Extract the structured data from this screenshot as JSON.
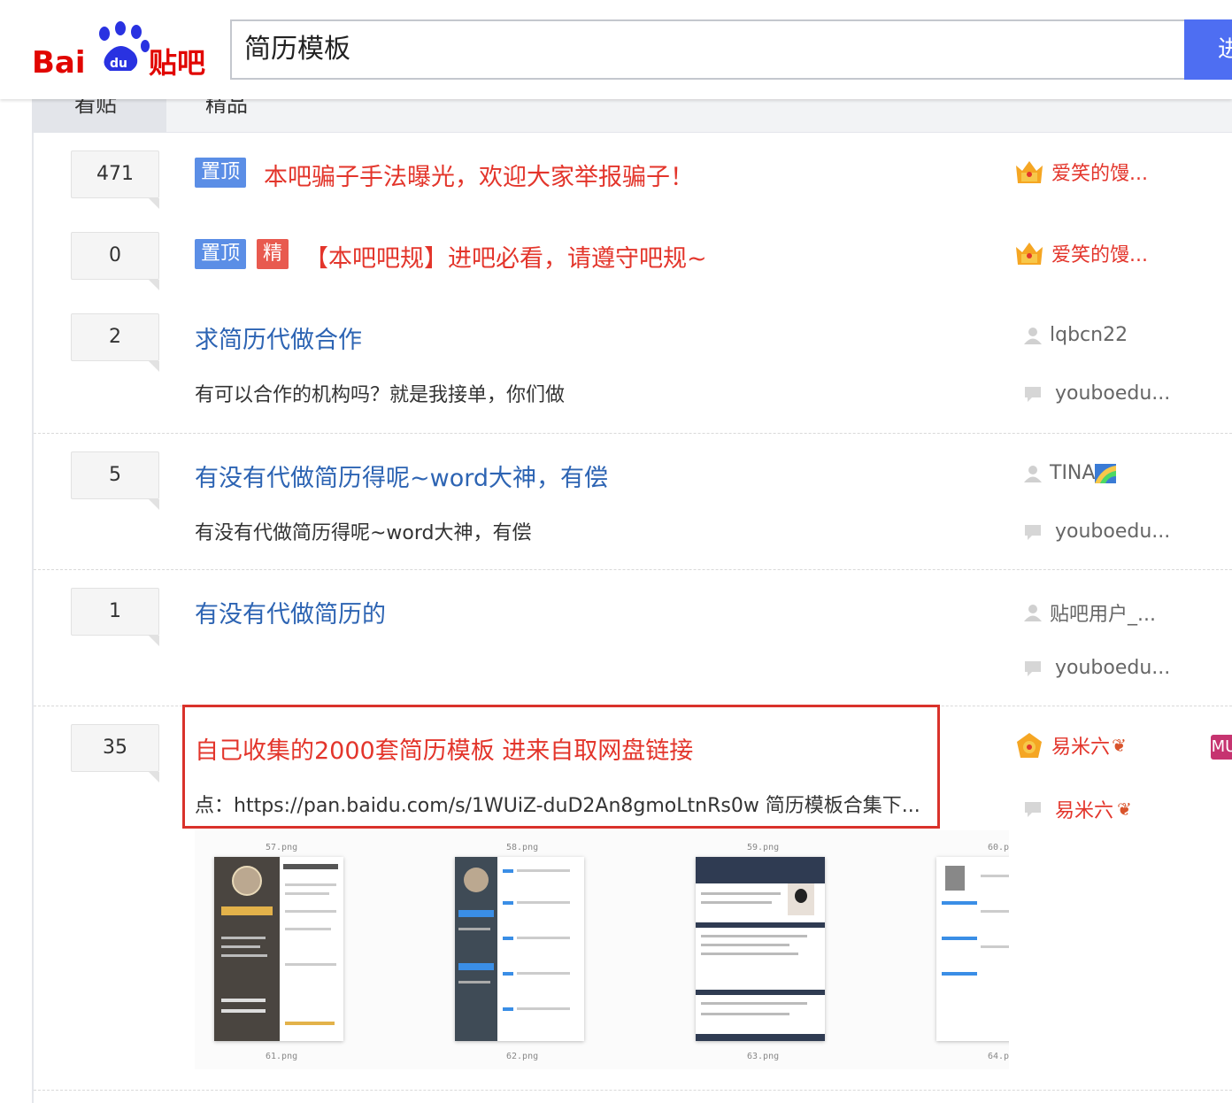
{
  "header": {
    "logo_text": "Bai du 贴吧",
    "search_value": "简历模板",
    "search_button_label": "进"
  },
  "tabs": [
    {
      "label": "看贴"
    },
    {
      "label": "精品"
    }
  ],
  "threads": [
    {
      "reply_count": "471",
      "badges": [
        "置顶"
      ],
      "title": "本吧骗子手法曝光，欢迎大家举报骗子！",
      "author": "爱笑的馒..."
    },
    {
      "reply_count": "0",
      "badges": [
        "置顶",
        "精"
      ],
      "title": "【本吧吧规】进吧必看，请遵守吧规~",
      "author": "爱笑的馒..."
    },
    {
      "reply_count": "2",
      "title": "求简历代做合作",
      "abstract": "有可以合作的机构吗？就是我接单，你们做",
      "author": "lqbcn22",
      "last_reply": "youboedu..."
    },
    {
      "reply_count": "5",
      "title": "有没有代做简历得呢~word大神，有偿",
      "abstract": "有没有代做简历得呢~word大神，有偿",
      "author": "TINA",
      "last_reply": "youboedu..."
    },
    {
      "reply_count": "1",
      "title": "有没有代做简历的",
      "abstract": "",
      "author": "贴吧用户_...",
      "last_reply": "youboedu..."
    },
    {
      "reply_count": "35",
      "title": "自己收集的2000套简历模板 进来自取网盘链接",
      "abstract": "点：https://pan.baidu.com/s/1WUiZ-duD2An8gmoLtnRs0w 简历模板合集下...",
      "author": "易米六",
      "last_reply": "易米六",
      "extra_icon": "MU"
    }
  ],
  "thumbnails": {
    "top_captions": [
      "57.png",
      "58.png",
      "59.png",
      "60.p"
    ],
    "bottom_captions": [
      "61.png",
      "62.png",
      "63.png",
      "64.p"
    ]
  },
  "colors": {
    "title_red": "#e3352b",
    "title_blue": "#2d64b3",
    "badge_top": "#5b8ee6",
    "badge_good": "#e85a4f",
    "search_btn": "#4e6ef2",
    "highlight_border": "#d9322b"
  }
}
